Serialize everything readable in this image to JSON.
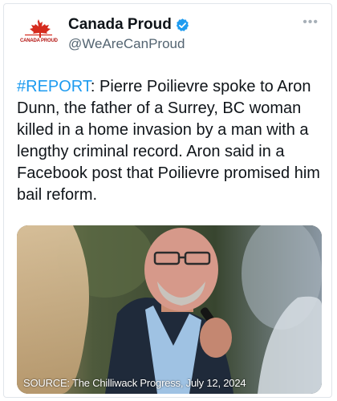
{
  "account": {
    "display_name": "Canada Proud",
    "handle": "@WeAreCanProud",
    "verified": true,
    "avatar_label": "CANADA PROUD"
  },
  "tweet": {
    "hashtag": "#REPORT",
    "body": ": Pierre Poilievre spoke to Aron Dunn, the father of a Surrey, BC woman killed in a home invasion by a man with a lengthy criminal record. Aron said in a Facebook post that Poilievre promised him bail reform."
  },
  "media": {
    "caption": "SOURCE: The Chilliwack Progress, July 12, 2024"
  },
  "icons": {
    "more": "more-options-icon",
    "verified": "verified-badge-icon",
    "avatar": "maple-leaf-logo"
  },
  "colors": {
    "accent": "#1d9bf0",
    "text": "#0f1419",
    "secondary": "#536471",
    "brand_red": "#d52b1e"
  }
}
